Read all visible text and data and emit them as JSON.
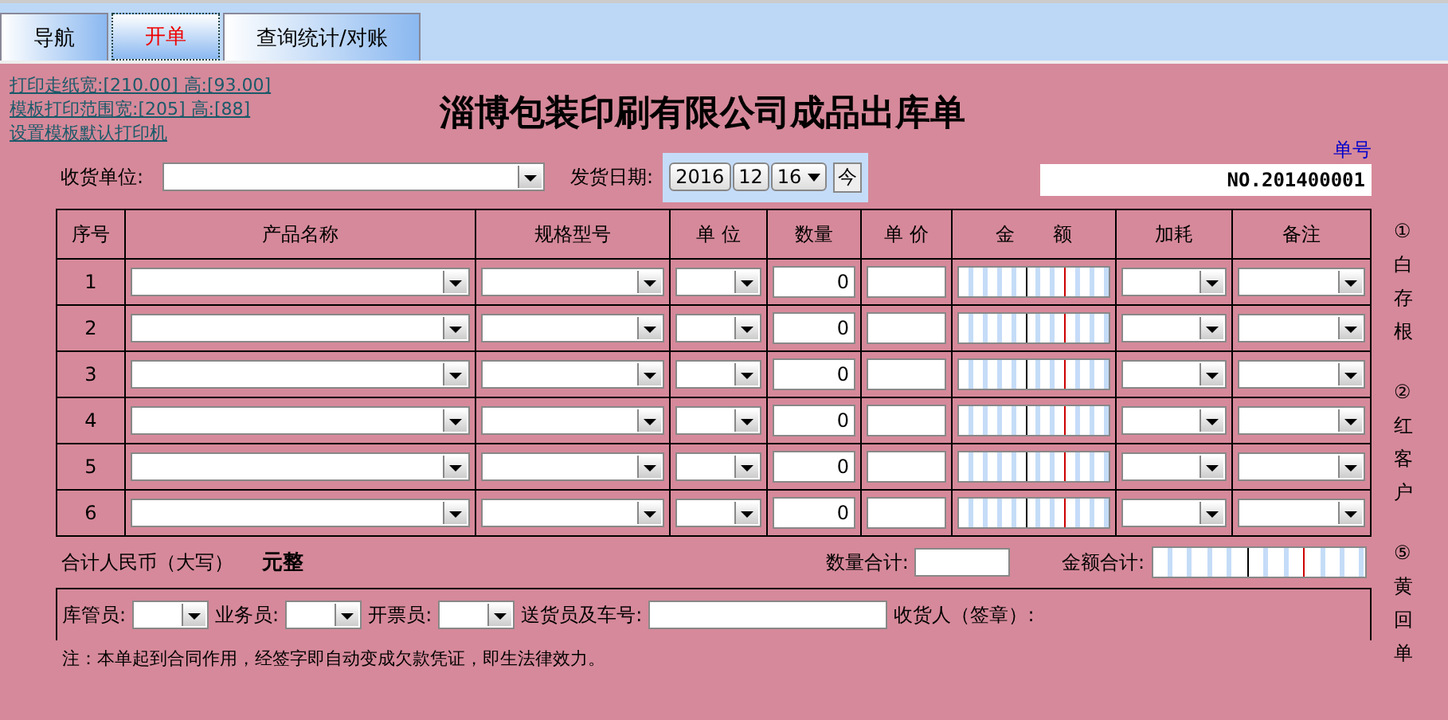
{
  "tabs": [
    {
      "label": "导航",
      "selected": false
    },
    {
      "label": "开单",
      "selected": true
    },
    {
      "label": "查询统计/对账",
      "selected": false
    }
  ],
  "print_links": [
    "打印走纸宽:[210.00] 高:[93.00]",
    "模板打印范围宽:[205] 高:[88]",
    "设置模板默认打印机"
  ],
  "title": "淄博包装印刷有限公司成品出库单",
  "order_no_label": "单号",
  "order_no": "NO.201400001",
  "receiver_label": "收货单位:",
  "date_label": "发货日期:",
  "date": {
    "year": "2016",
    "month": "12",
    "day": "16",
    "today_button": "今"
  },
  "table": {
    "columns": [
      "序号",
      "产品名称",
      "规格型号",
      "单 位",
      "数量",
      "单 价",
      "金　　额",
      "加耗",
      "备注"
    ],
    "rows": [
      {
        "seq": "1",
        "quantity": "0"
      },
      {
        "seq": "2",
        "quantity": "0"
      },
      {
        "seq": "3",
        "quantity": "0"
      },
      {
        "seq": "4",
        "quantity": "0"
      },
      {
        "seq": "5",
        "quantity": "0"
      },
      {
        "seq": "6",
        "quantity": "0"
      }
    ]
  },
  "total": {
    "label": "合计人民币（大写）",
    "amount_words": "元整",
    "qty_label": "数量合计:",
    "amount_label": "金额合计:"
  },
  "staff": [
    {
      "label": "库管员:",
      "kind": "combo"
    },
    {
      "label": "业务员:",
      "kind": "combo"
    },
    {
      "label": "开票员:",
      "kind": "combo"
    },
    {
      "label": "送货员及车号:",
      "kind": "text"
    },
    {
      "label": "收货人（签章）:",
      "kind": "none"
    }
  ],
  "note": "注：本单起到合同作用，经签字即自动变成欠款凭证，即生法律效力。",
  "copies": [
    "①",
    "白",
    "存",
    "根",
    "②",
    "红",
    "客",
    "户",
    "⑤",
    "黄",
    "回",
    "单"
  ]
}
